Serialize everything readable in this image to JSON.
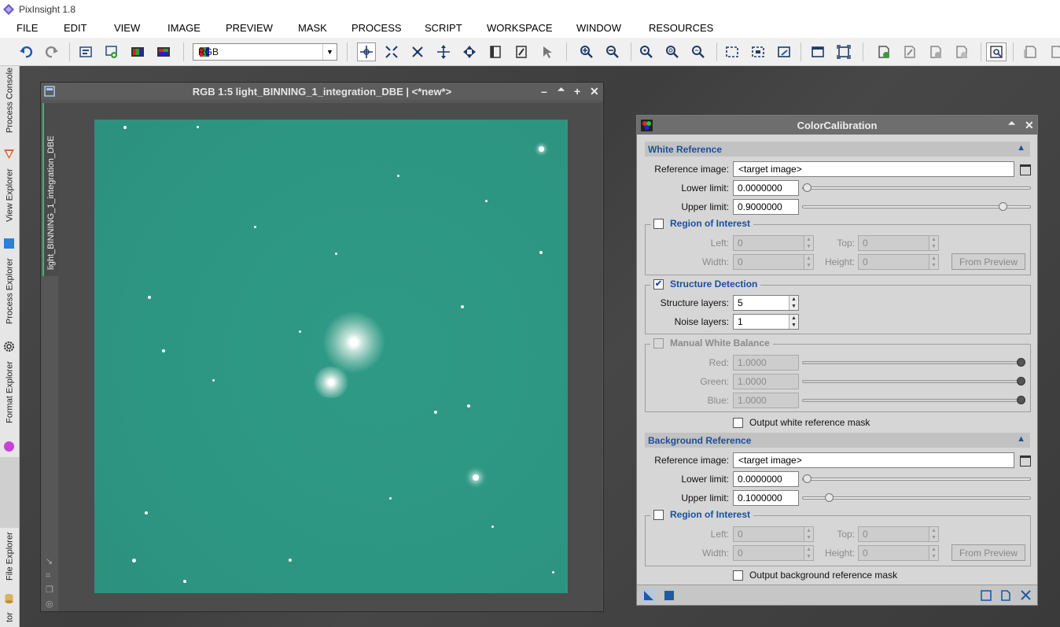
{
  "app": {
    "title": "PixInsight 1.8"
  },
  "menu": [
    "FILE",
    "EDIT",
    "VIEW",
    "IMAGE",
    "PREVIEW",
    "MASK",
    "PROCESS",
    "SCRIPT",
    "WORKSPACE",
    "WINDOW",
    "RESOURCES"
  ],
  "toolbar": {
    "channel_combo": "RGB"
  },
  "left_dock": {
    "process_console": "Process Console",
    "view_explorer": "View Explorer",
    "process_explorer": "Process Explorer",
    "format_explorer": "Format Explorer",
    "file_explorer": "File Explorer",
    "bottom_partial": "tor"
  },
  "image_window": {
    "title": "RGB 1:5 light_BINNING_1_integration_DBE | <*new*>",
    "view_tab": "light_BINNING_1_integration_DBE"
  },
  "color_calibration": {
    "title": "ColorCalibration",
    "white_ref": {
      "section": "White Reference",
      "reference_image_label": "Reference image:",
      "reference_image": "<target image>",
      "lower_limit_label": "Lower limit:",
      "lower_limit": "0.0000000",
      "lower_limit_frac": 0.0,
      "upper_limit_label": "Upper limit:",
      "upper_limit": "0.9000000",
      "upper_limit_frac": 0.9,
      "roi": {
        "title": "Region of Interest",
        "left_label": "Left:",
        "left": "0",
        "top_label": "Top:",
        "top": "0",
        "width_label": "Width:",
        "width": "0",
        "height_label": "Height:",
        "height": "0",
        "from_preview": "From Preview"
      },
      "structure": {
        "title": "Structure Detection",
        "layers_label": "Structure layers:",
        "layers": "5",
        "noise_label": "Noise layers:",
        "noise": "1"
      },
      "manual_wb": {
        "title": "Manual White Balance",
        "red_label": "Red:",
        "red": "1.0000",
        "green_label": "Green:",
        "green": "1.0000",
        "blue_label": "Blue:",
        "blue": "1.0000"
      },
      "output_mask": "Output white reference mask"
    },
    "bg_ref": {
      "section": "Background Reference",
      "reference_image_label": "Reference image:",
      "reference_image": "<target image>",
      "lower_limit_label": "Lower limit:",
      "lower_limit": "0.0000000",
      "lower_limit_frac": 0.0,
      "upper_limit_label": "Upper limit:",
      "upper_limit": "0.1000000",
      "upper_limit_frac": 0.1,
      "roi": {
        "title": "Region of Interest",
        "left_label": "Left:",
        "left": "0",
        "top_label": "Top:",
        "top": "0",
        "width_label": "Width:",
        "width": "0",
        "height_label": "Height:",
        "height": "0",
        "from_preview": "From Preview"
      },
      "output_mask": "Output background reference mask"
    }
  }
}
